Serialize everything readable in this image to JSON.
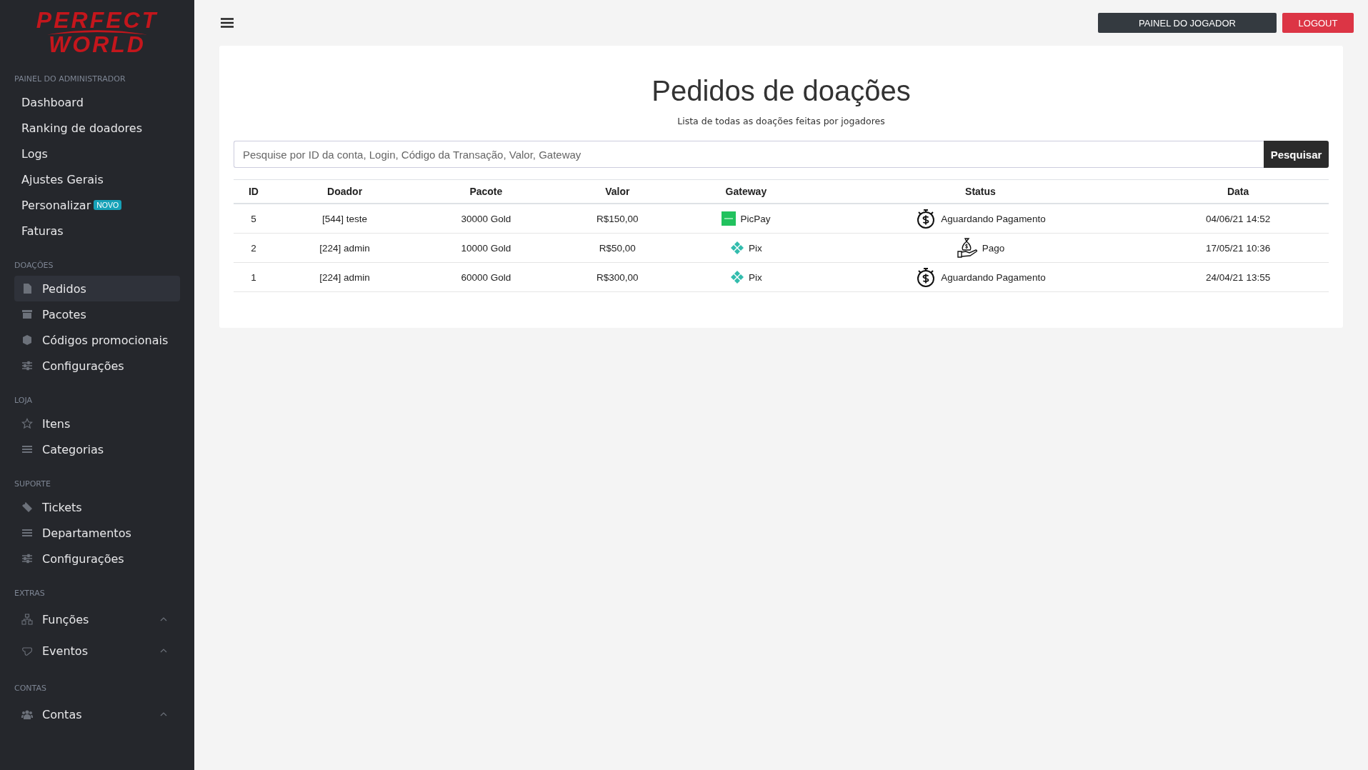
{
  "logo": {
    "line_1": "PERFECT",
    "line_2": "WORLD"
  },
  "sidebar": {
    "sections": [
      {
        "title": "PAINEL DO ADMINISTRADOR",
        "items": [
          {
            "label": "Dashboard",
            "selected": false,
            "has_submenu": false
          },
          {
            "label": "Ranking de doadores",
            "selected": false,
            "has_submenu": false
          },
          {
            "label": "Logs",
            "selected": false,
            "has_submenu": false
          },
          {
            "label": "Ajustes Gerais",
            "selected": false,
            "has_submenu": false
          },
          {
            "label": "Personalizar",
            "badge": "NOVO",
            "selected": false,
            "has_submenu": false
          },
          {
            "label": "Faturas",
            "selected": false,
            "has_submenu": false
          }
        ]
      },
      {
        "title": "DOAÇÕES",
        "items": [
          {
            "label": "Pedidos",
            "selected": true,
            "has_submenu": false
          },
          {
            "label": "Pacotes",
            "selected": false,
            "has_submenu": false
          },
          {
            "label": "Códigos promocionais",
            "selected": false,
            "has_submenu": false
          },
          {
            "label": "Configurações",
            "selected": false,
            "has_submenu": false
          }
        ]
      },
      {
        "title": "LOJA",
        "items": [
          {
            "label": "Itens",
            "selected": false,
            "has_submenu": false
          },
          {
            "label": "Categorias",
            "selected": false,
            "has_submenu": false
          }
        ]
      },
      {
        "title": "SUPORTE",
        "items": [
          {
            "label": "Tickets",
            "selected": false,
            "has_submenu": false
          },
          {
            "label": "Departamentos",
            "selected": false,
            "has_submenu": false
          },
          {
            "label": "Configurações",
            "selected": false,
            "has_submenu": false
          }
        ]
      },
      {
        "title": "EXTRAS",
        "items": [
          {
            "label": "Funções",
            "selected": false,
            "has_submenu": true
          },
          {
            "label": "Eventos",
            "selected": false,
            "has_submenu": true
          }
        ]
      },
      {
        "title": "CONTAS",
        "items": [
          {
            "label": "Contas",
            "selected": false,
            "has_submenu": true
          }
        ]
      }
    ]
  },
  "header": {
    "buttons": [
      {
        "label": "PAINEL DO JOGADOR",
        "kind": "dark"
      },
      {
        "label": "LOGOUT",
        "kind": "danger"
      }
    ]
  },
  "page": {
    "title": "Pedidos de doações",
    "subtitle": "Lista de todas as doações feitas por jogadores"
  },
  "search": {
    "placeholder": "Pesquise por ID da conta, Login, Código da Transação, Valor, Gateway",
    "button": "Pesquisar"
  },
  "table": {
    "columns": [
      "ID",
      "Doador",
      "Pacote",
      "Valor",
      "Gateway",
      "Status",
      "Data"
    ],
    "rows": [
      {
        "id": "5",
        "donor": "[544] teste",
        "package": "30000 Gold",
        "value": "R$150,00",
        "gateway": {
          "kind": "picpay",
          "label": "PicPay"
        },
        "status": {
          "kind": "pending",
          "label": "Aguardando Pagamento"
        },
        "date": "04/06/21 14:52"
      },
      {
        "id": "2",
        "donor": "[224] admin",
        "package": "10000 Gold",
        "value": "R$50,00",
        "gateway": {
          "kind": "pix",
          "label": "Pix"
        },
        "status": {
          "kind": "paid",
          "label": "Pago"
        },
        "date": "17/05/21 10:36"
      },
      {
        "id": "1",
        "donor": "[224] admin",
        "package": "60000 Gold",
        "value": "R$300,00",
        "gateway": {
          "kind": "pix",
          "label": "Pix"
        },
        "status": {
          "kind": "pending",
          "label": "Aguardando Pagamento"
        },
        "date": "24/04/21 13:55"
      }
    ]
  }
}
